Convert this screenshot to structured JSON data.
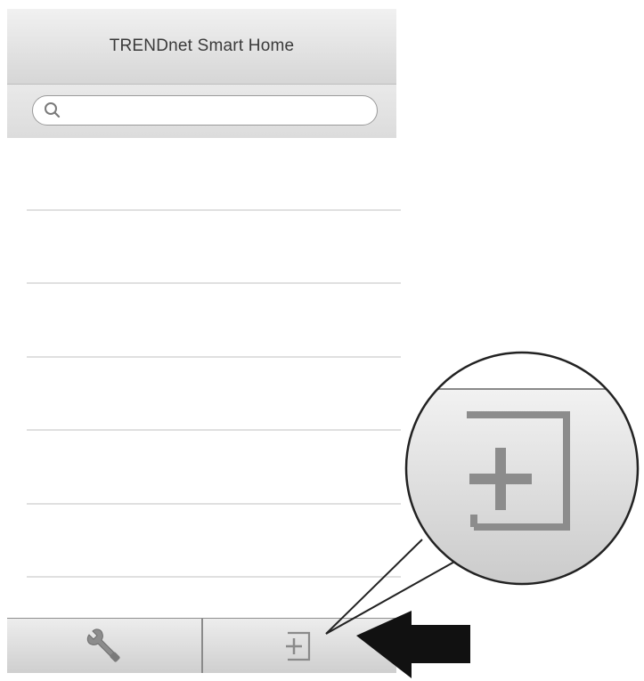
{
  "navbar": {
    "title": "TRENDnet Smart Home"
  },
  "search": {
    "value": "",
    "placeholder": "",
    "icon": "search-icon"
  },
  "list": {
    "rows": [
      "",
      "",
      "",
      "",
      ""
    ]
  },
  "tabbar": {
    "items": [
      {
        "icon": "wrench-icon"
      },
      {
        "icon": "add-device-icon"
      }
    ]
  },
  "callout": {
    "icon": "add-device-icon",
    "arrow": "left-arrow-icon"
  },
  "colors": {
    "navbar": "#e4e4e4",
    "icon_gray": "#8a8a8a",
    "arrow": "#111111"
  }
}
